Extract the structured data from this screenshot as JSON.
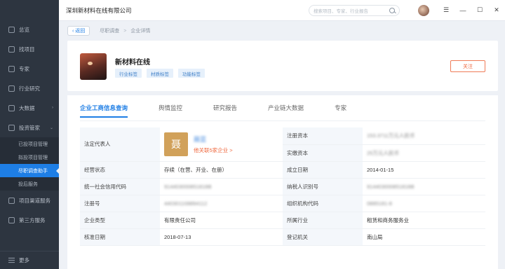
{
  "sidebar": {
    "items": [
      {
        "label": "总览",
        "icon": "home-icon"
      },
      {
        "label": "找项目",
        "icon": "search-project-icon"
      },
      {
        "label": "专家",
        "icon": "expert-icon"
      },
      {
        "label": "行业研究",
        "icon": "research-icon"
      },
      {
        "label": "大数据",
        "icon": "bigdata-icon",
        "caret": "›"
      },
      {
        "label": "投资管家",
        "icon": "invest-icon",
        "caret": "⌄"
      }
    ],
    "subitems": [
      {
        "label": "已投项目管理"
      },
      {
        "label": "拟投项目管理"
      },
      {
        "label": "尽职调查助手",
        "active": true
      },
      {
        "label": "投后服务"
      }
    ],
    "items2": [
      {
        "label": "项目渠道服务",
        "icon": "channel-icon"
      },
      {
        "label": "第三方服务",
        "icon": "thirdparty-icon"
      }
    ],
    "more": "更多"
  },
  "topbar": {
    "company": "深圳新材料在线有限公司",
    "search_placeholder": "搜索项目、专家、行业报告"
  },
  "breadcrumb": {
    "back": "返回",
    "items": [
      "尽职调查",
      "企业详情"
    ]
  },
  "header": {
    "name": "新材料在线",
    "tags": [
      "行业标签",
      "材质标签",
      "功能标签"
    ],
    "follow": "关注"
  },
  "tabs": [
    "企业工商信息查询",
    "舆情监控",
    "研究报告",
    "产业链大数据",
    "专家"
  ],
  "info": {
    "legal_rep_label": "法定代表人",
    "legal_rep_badge": "聂",
    "legal_rep_name": "聂蓝",
    "legal_rep_link": "他关联5家企业 >",
    "reg_capital_label": "注册资本",
    "reg_capital_value": "153.3711万元人民币",
    "paid_capital_label": "实缴资本",
    "paid_capital_value": "25万元人民币",
    "status_label": "经营状态",
    "status_value": "存续（在营、开业、在册）",
    "founded_label": "成立日期",
    "founded_value": "2014-01-15",
    "credit_code_label": "统一社会信用代码",
    "credit_code_value": "914403000851818B",
    "taxpayer_label": "纳税人识别号",
    "taxpayer_value": "914403000851818B",
    "reg_no_label": "注册号",
    "reg_no_value": "440301108894112",
    "org_code_label": "组织机构代码",
    "org_code_value": "0885181-8",
    "type_label": "企业类型",
    "type_value": "有限责任公司",
    "industry_label": "所属行业",
    "industry_value": "租赁和商务服务业",
    "approve_label": "核准日期",
    "approve_value": "2018-07-13",
    "authority_label": "登记机关",
    "authority_value": "南山局"
  }
}
